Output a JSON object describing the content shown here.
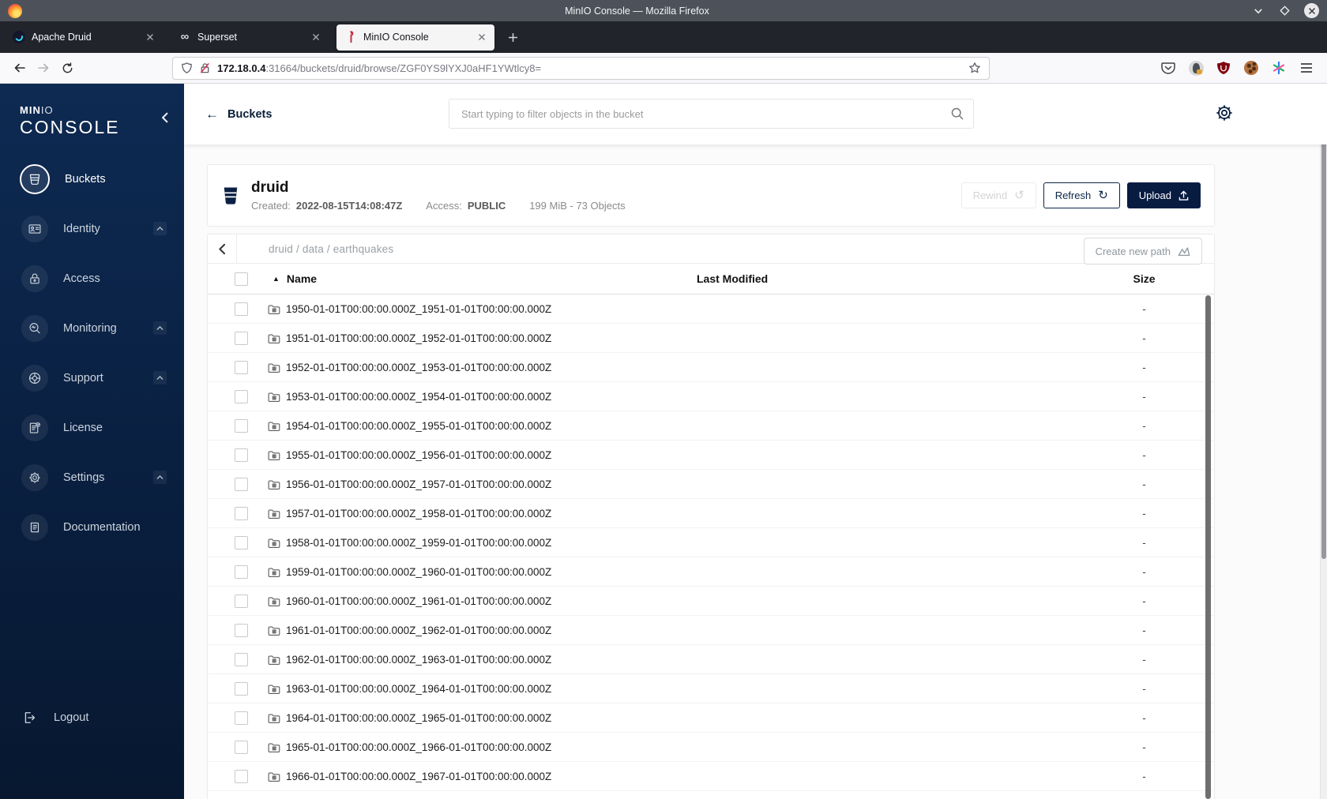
{
  "icons": {
    "back_arrow": "←",
    "refresh_arrow": "↻",
    "rewind_arrow": "↺",
    "sort_asc": "▲",
    "infinity": "∞"
  },
  "colors": {
    "accent_navy": "#081C42",
    "minio_red": "#C72E49",
    "sidebar_top": "#0E2A52",
    "ublock_red": "#800610"
  },
  "browser": {
    "window_title": "MinIO Console — Mozilla Firefox",
    "tabs": [
      {
        "label": "Apache Druid",
        "active": false
      },
      {
        "label": "Superset",
        "active": false
      },
      {
        "label": "MinIO Console",
        "active": true
      }
    ],
    "url_host": "172.18.0.4",
    "url_rest": ":31664/buckets/druid/browse/ZGF0YS9lYXJ0aHF1YWtlcy8="
  },
  "sidebar": {
    "logo_bold": "MIN",
    "logo_light": "IO",
    "logo_line2": "CONSOLE",
    "items": [
      {
        "label": "Buckets",
        "icon": "bucket-icon",
        "active": true,
        "expandable": false
      },
      {
        "label": "Identity",
        "icon": "identity-card-icon",
        "active": false,
        "expandable": true
      },
      {
        "label": "Access",
        "icon": "lock-icon",
        "active": false,
        "expandable": false
      },
      {
        "label": "Monitoring",
        "icon": "monitor-search-icon",
        "active": false,
        "expandable": true
      },
      {
        "label": "Support",
        "icon": "lifebuoy-icon",
        "active": false,
        "expandable": true
      },
      {
        "label": "License",
        "icon": "license-doc-icon",
        "active": false,
        "expandable": false
      },
      {
        "label": "Settings",
        "icon": "gear-icon",
        "active": false,
        "expandable": true
      },
      {
        "label": "Documentation",
        "icon": "book-icon",
        "active": false,
        "expandable": false
      }
    ],
    "logout_label": "Logout"
  },
  "app_header": {
    "back_label": "Buckets",
    "search_placeholder": "Start typing to filter objects in the bucket"
  },
  "bucket": {
    "name": "druid",
    "created_label": "Created:",
    "created_value": "2022-08-15T14:08:47Z",
    "access_label": "Access:",
    "access_value": "PUBLIC",
    "stats": "199 MiB - 73 Objects",
    "rewind_label": "Rewind",
    "refresh_label": "Refresh",
    "upload_label": "Upload"
  },
  "browse": {
    "breadcrumb": [
      "druid",
      "data",
      "earthquakes"
    ],
    "breadcrumb_display": "druid / data / earthquakes",
    "create_path_label": "Create new path",
    "table": {
      "columns": [
        "Name",
        "Last Modified",
        "Size"
      ],
      "sort_column": "Name",
      "sort_direction": "asc",
      "rows": [
        {
          "name": "1950-01-01T00:00:00.000Z_1951-01-01T00:00:00.000Z",
          "size": "-"
        },
        {
          "name": "1951-01-01T00:00:00.000Z_1952-01-01T00:00:00.000Z",
          "size": "-"
        },
        {
          "name": "1952-01-01T00:00:00.000Z_1953-01-01T00:00:00.000Z",
          "size": "-"
        },
        {
          "name": "1953-01-01T00:00:00.000Z_1954-01-01T00:00:00.000Z",
          "size": "-"
        },
        {
          "name": "1954-01-01T00:00:00.000Z_1955-01-01T00:00:00.000Z",
          "size": "-"
        },
        {
          "name": "1955-01-01T00:00:00.000Z_1956-01-01T00:00:00.000Z",
          "size": "-"
        },
        {
          "name": "1956-01-01T00:00:00.000Z_1957-01-01T00:00:00.000Z",
          "size": "-"
        },
        {
          "name": "1957-01-01T00:00:00.000Z_1958-01-01T00:00:00.000Z",
          "size": "-"
        },
        {
          "name": "1958-01-01T00:00:00.000Z_1959-01-01T00:00:00.000Z",
          "size": "-"
        },
        {
          "name": "1959-01-01T00:00:00.000Z_1960-01-01T00:00:00.000Z",
          "size": "-"
        },
        {
          "name": "1960-01-01T00:00:00.000Z_1961-01-01T00:00:00.000Z",
          "size": "-"
        },
        {
          "name": "1961-01-01T00:00:00.000Z_1962-01-01T00:00:00.000Z",
          "size": "-"
        },
        {
          "name": "1962-01-01T00:00:00.000Z_1963-01-01T00:00:00.000Z",
          "size": "-"
        },
        {
          "name": "1963-01-01T00:00:00.000Z_1964-01-01T00:00:00.000Z",
          "size": "-"
        },
        {
          "name": "1964-01-01T00:00:00.000Z_1965-01-01T00:00:00.000Z",
          "size": "-"
        },
        {
          "name": "1965-01-01T00:00:00.000Z_1966-01-01T00:00:00.000Z",
          "size": "-"
        },
        {
          "name": "1966-01-01T00:00:00.000Z_1967-01-01T00:00:00.000Z",
          "size": "-"
        }
      ]
    }
  }
}
